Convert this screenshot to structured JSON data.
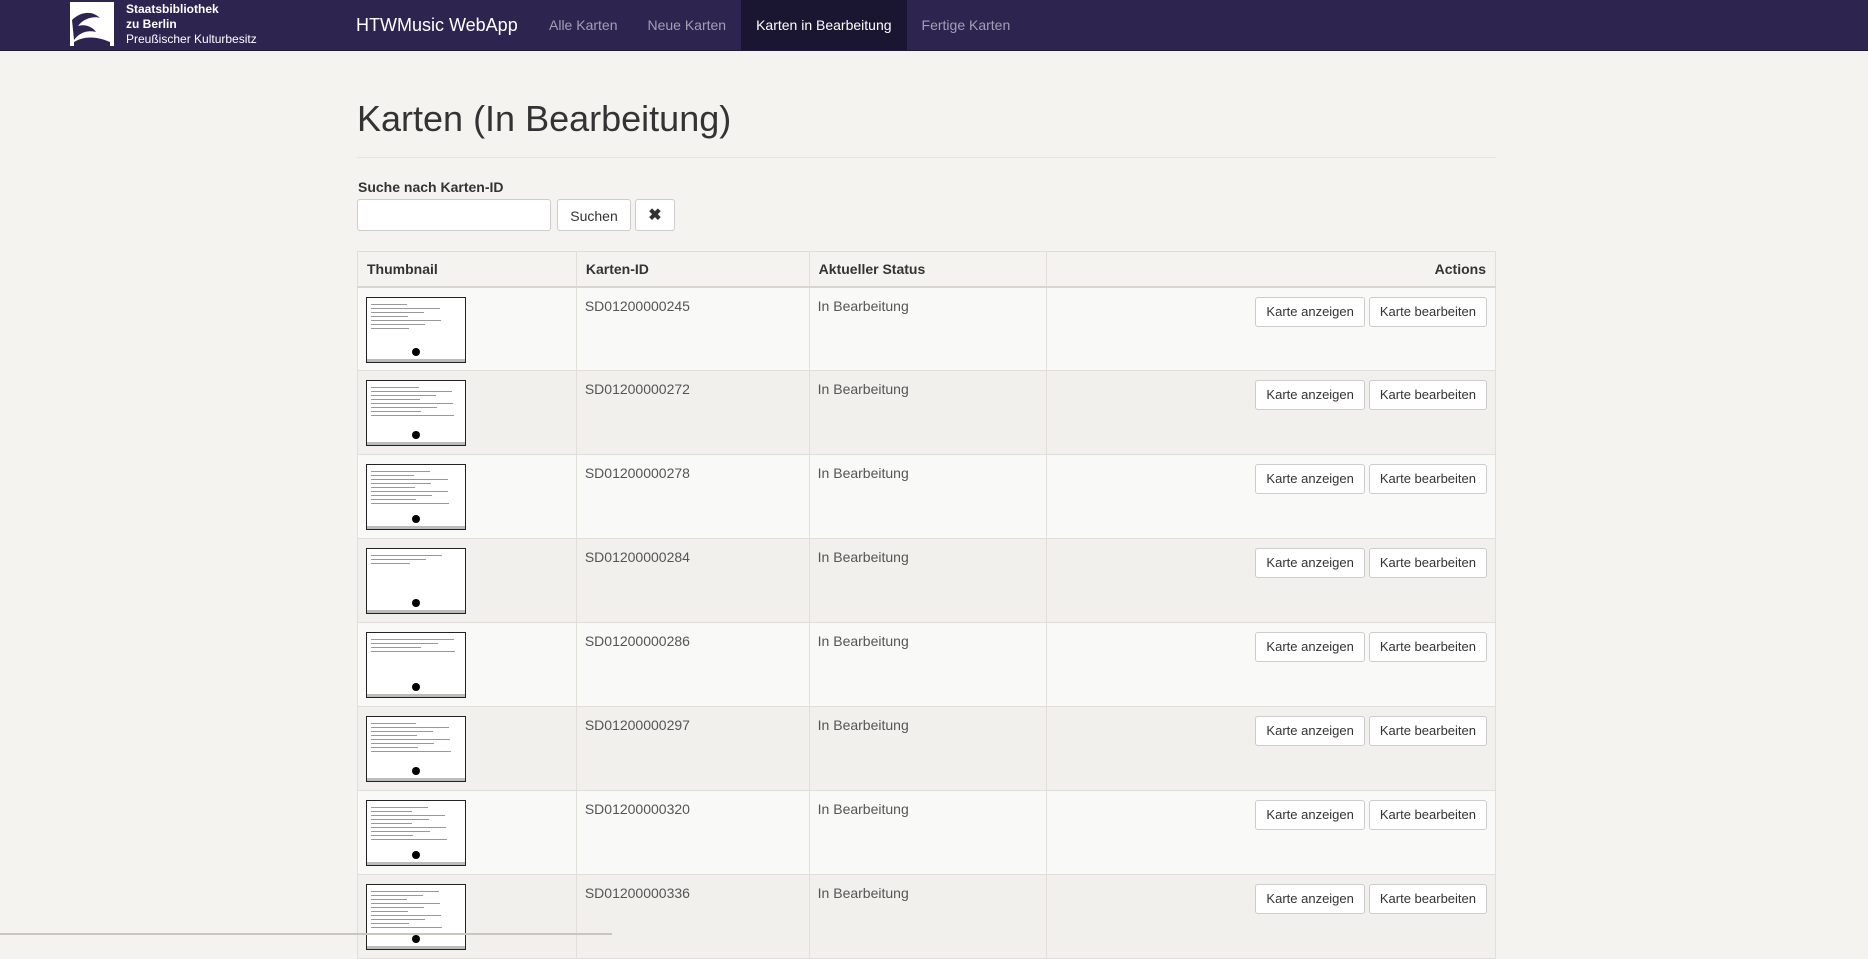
{
  "logo": {
    "line1": "Staatsbibliothek",
    "line2": "zu Berlin",
    "line3": "Preußischer Kulturbesitz"
  },
  "navbar": {
    "brand": "HTWMusic WebApp",
    "items": [
      {
        "label": "Alle Karten",
        "active": false
      },
      {
        "label": "Neue Karten",
        "active": false
      },
      {
        "label": "Karten in Bearbeitung",
        "active": true
      },
      {
        "label": "Fertige Karten",
        "active": false
      }
    ]
  },
  "page": {
    "title": "Karten (In Bearbeitung)"
  },
  "search": {
    "label": "Suche nach Karten-ID",
    "value": "",
    "button": "Suchen",
    "clear": "✖"
  },
  "table": {
    "headers": {
      "thumbnail": "Thumbnail",
      "id": "Karten-ID",
      "status": "Aktueller Status",
      "actions": "Actions"
    },
    "view_label": "Karte anzeigen",
    "edit_label": "Karte bearbeiten",
    "rows": [
      {
        "id": "SD01200000245",
        "status": "In Bearbeitung"
      },
      {
        "id": "SD01200000272",
        "status": "In Bearbeitung"
      },
      {
        "id": "SD01200000278",
        "status": "In Bearbeitung"
      },
      {
        "id": "SD01200000284",
        "status": "In Bearbeitung"
      },
      {
        "id": "SD01200000286",
        "status": "In Bearbeitung"
      },
      {
        "id": "SD01200000297",
        "status": "In Bearbeitung"
      },
      {
        "id": "SD01200000320",
        "status": "In Bearbeitung"
      },
      {
        "id": "SD01200000336",
        "status": "In Bearbeitung"
      }
    ]
  }
}
